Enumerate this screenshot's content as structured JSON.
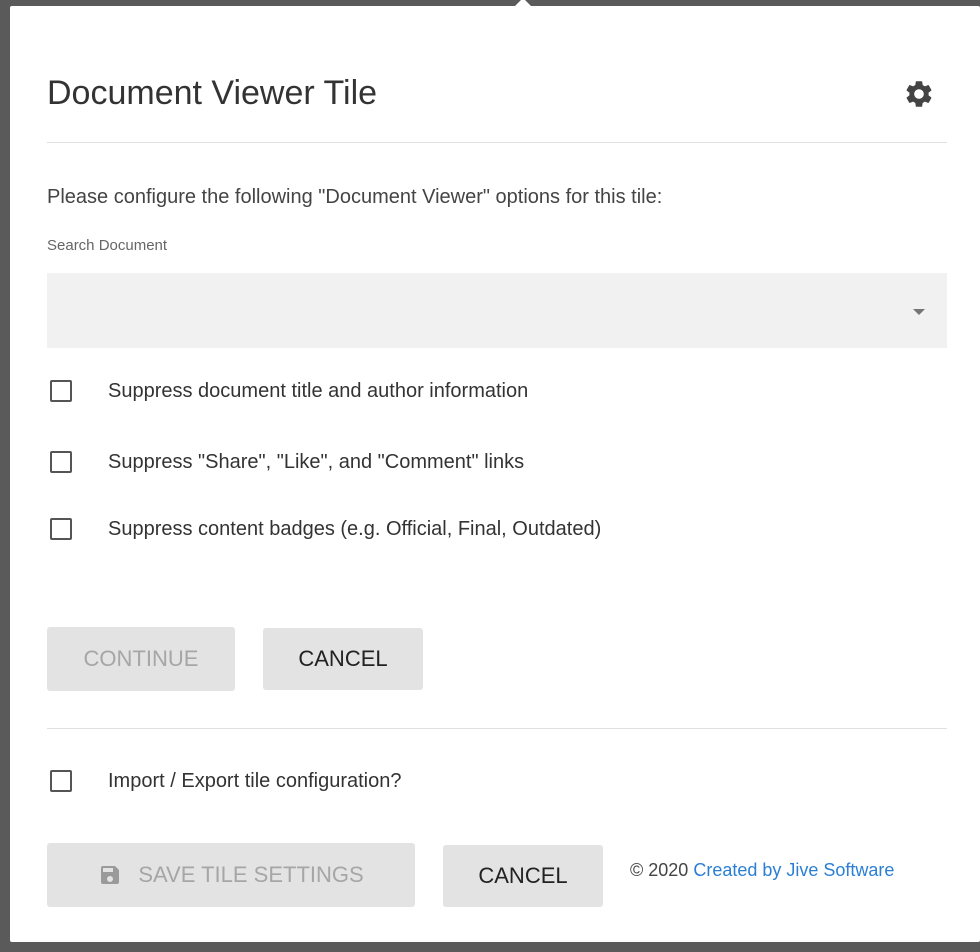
{
  "dialog": {
    "title": "Document Viewer Tile",
    "prompt": "Please configure the following \"Document Viewer\" options for this tile:",
    "search": {
      "label": "Search Document",
      "value": ""
    },
    "options": [
      {
        "label": "Suppress document title and author information",
        "checked": false
      },
      {
        "label": "Suppress \"Share\", \"Like\", and \"Comment\" links",
        "checked": false
      },
      {
        "label": "Suppress content badges (e.g. Official, Final, Outdated)",
        "checked": false
      }
    ],
    "continue_label": "CONTINUE",
    "cancel_label": "CANCEL",
    "import_export_label": "Import / Export tile configuration?",
    "save_label": "SAVE TILE SETTINGS",
    "cancel2_label": "CANCEL",
    "footer": {
      "copyright": "© 2020",
      "link_text": "Created by Jive Software"
    }
  },
  "icons": {
    "settings": "gear-icon",
    "dropdown": "chevron-down-icon",
    "save": "floppy-disk-icon"
  },
  "colors": {
    "link": "#2a7fd4",
    "button_bg": "#e3e3e3",
    "disabled_text": "#a6a6a6",
    "field_bg": "#f1f1f1"
  }
}
